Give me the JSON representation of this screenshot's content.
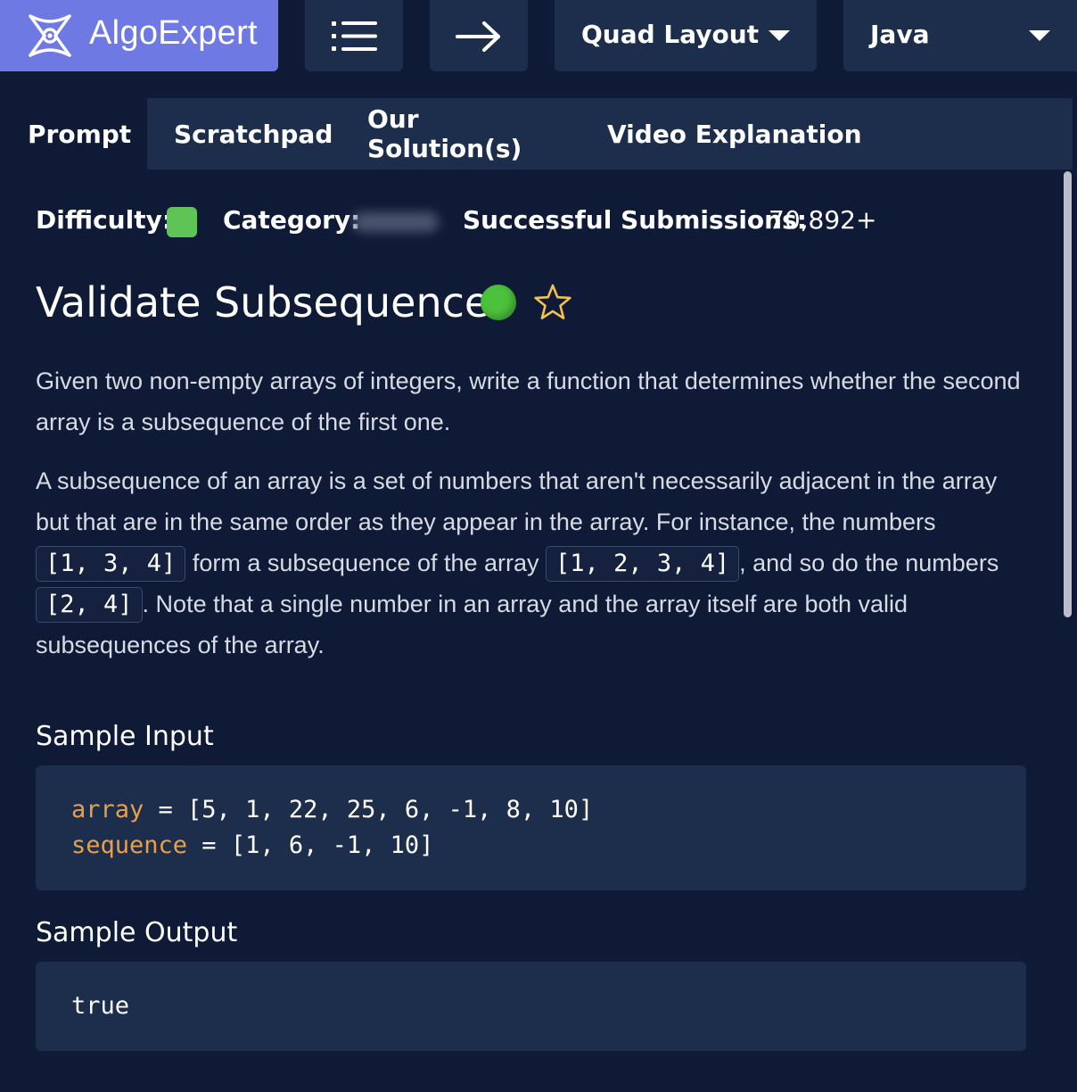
{
  "topbar": {
    "brand": "AlgoExpert",
    "layout_select": "Quad Layout",
    "language_select": "Java"
  },
  "tabs": [
    {
      "label": "Prompt",
      "active": true
    },
    {
      "label": "Scratchpad",
      "active": false
    },
    {
      "label": "Our Solution(s)",
      "active": false
    },
    {
      "label": "Video Explanation",
      "active": false
    }
  ],
  "meta": {
    "difficulty_label": "Difficulty:",
    "difficulty_color": "#5ec455",
    "category_label": "Category:",
    "submissions_label": "Successful Submissions:",
    "submissions_value": "70,892+"
  },
  "question": {
    "title": "Validate Subsequence",
    "status_color": "#4cc23c",
    "p1": "Given two non-empty arrays of integers, write a function that determines whether the second array is a subsequence of the first one.",
    "p2_a": "A subsequence of an array is a set of numbers that aren't necessarily adjacent in the array but that are in the same order as they appear in the array. For instance, the numbers ",
    "p2_code1": "[1, 3, 4]",
    "p2_b": " form a subsequence of the array ",
    "p2_code2": "[1, 2, 3, 4]",
    "p2_c": ", and so do the numbers ",
    "p2_code3": "[2, 4]",
    "p2_d": ". Note that a single number in an array and the array itself are both valid subsequences of the array."
  },
  "sample_input": {
    "title": "Sample Input",
    "line1_var": "array",
    "line1_val": " = [5, 1, 22, 25, 6, -1, 8, 10]",
    "line2_var": "sequence",
    "line2_val": " = [1, 6, -1, 10]"
  },
  "sample_output": {
    "title": "Sample Output",
    "value": "true"
  }
}
